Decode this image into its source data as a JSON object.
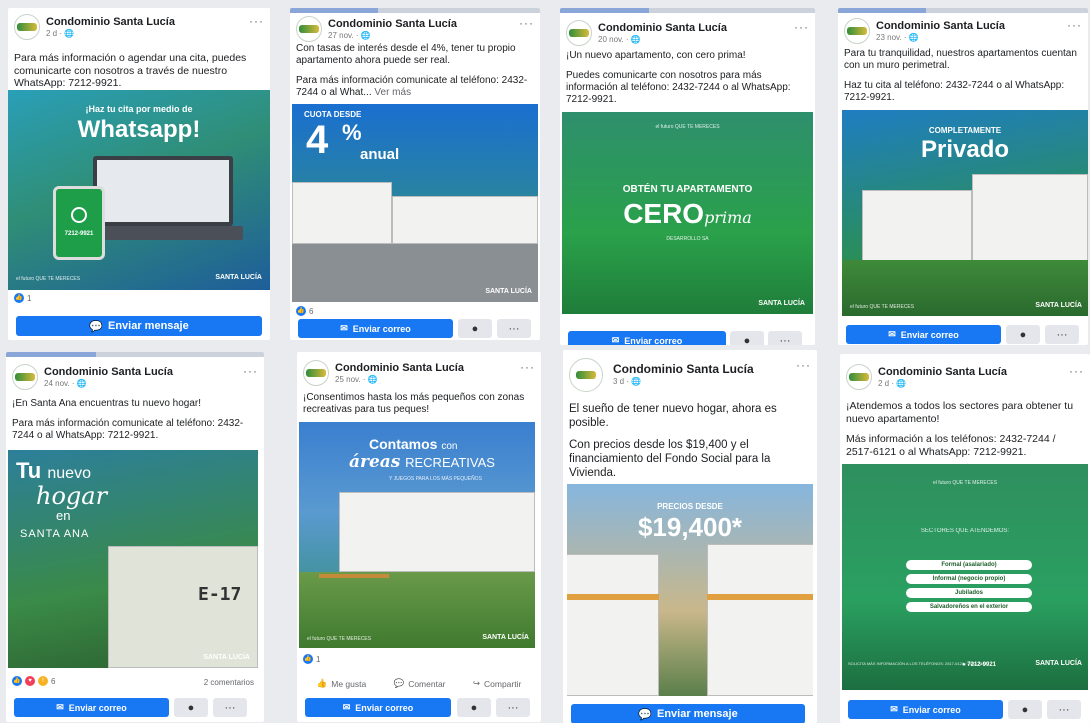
{
  "page": {
    "name": "Condominio Santa Lucía",
    "menu_dots": "···"
  },
  "icons": {
    "messenger": "messenger-icon",
    "mail": "mail-icon",
    "like": "thumbs-up-icon",
    "comment": "comment-icon",
    "share": "share-icon",
    "globe": "globe-icon"
  },
  "colors": {
    "facebook_blue": "#1877f2",
    "brand_green": "#2aa14a"
  },
  "actions": {
    "send_message": "Enviar mensaje",
    "send_email": "Enviar correo",
    "like": "Me gusta",
    "comment": "Comentar",
    "share": "Compartir"
  },
  "posts": [
    {
      "date": "2 d ·",
      "text": [
        "Para más información o agendar una cita, puedes comunicarte con nosotros a través de nuestro WhatsApp: 7212-9921."
      ],
      "img": {
        "top": "¡Haz tu cita por medio de",
        "main": "Whatsapp!",
        "phone": "7212-9921",
        "tag": "el futuro QUE TE MERECES",
        "logo": "SANTA LUCÍA"
      },
      "reactions": "1",
      "button": "Enviar mensaje"
    },
    {
      "date": "27 nov. ·",
      "text": [
        "Con tasas de interés desde el 4%, tener tu propio apartamento ahora puede ser real.",
        "Para más información comunicate al teléfono: 2432-7244 o al What..."
      ],
      "see_more": "Ver más",
      "img": {
        "top": "CUOTA DESDE",
        "big": "4",
        "pct": "%",
        "sub": "anual",
        "logo": "SANTA LUCÍA"
      },
      "reactions": "6",
      "button": "Enviar correo"
    },
    {
      "date": "20 nov. ·",
      "text": [
        "¡Un nuevo apartamento, con cero prima!",
        "Puedes comunicarte con nosotros para más información al teléfono: 2432-7244 o al WhatsApp: 7212-9921."
      ],
      "img": {
        "tag": "el futuro QUE TE MERECES",
        "top": "OBTÉN TU APARTAMENTO",
        "main": "CERO",
        "script": "prima",
        "note": "DESARROLLO SA",
        "logo": "SANTA LUCÍA"
      },
      "button": "Enviar correo"
    },
    {
      "date": "23 nov. ·",
      "text": [
        "Para tu tranquilidad, nuestros apartamentos cuentan con un muro perimetral.",
        "Haz tu cita al teléfono: 2432-7244  o al WhatsApp: 7212-9921."
      ],
      "img": {
        "top": "COMPLETAMENTE",
        "main": "Privado",
        "tag": "el futuro QUE TE MERECES",
        "logo": "SANTA LUCÍA"
      },
      "button": "Enviar correo"
    },
    {
      "date": "24 nov. ·",
      "text": [
        "¡En Santa Ana encuentras tu nuevo hogar!",
        "Para más información comunicate al teléfono: 2432-7244 o al WhatsApp: 7212-9921."
      ],
      "img": {
        "line1a": "Tu",
        "line1b": "nuevo",
        "line2": "hogar",
        "line3": "en",
        "line4": "SANTA ANA",
        "wall": "E-17",
        "logo": "SANTA LUCÍA"
      },
      "reactions": "6",
      "comments": "2 comentarios",
      "button": "Enviar correo"
    },
    {
      "date": "25 nov. ·",
      "text": [
        "¡Consentimos hasta los más pequeños con zonas recreativas para tus peques!"
      ],
      "img": {
        "main": "Contamos",
        "con": "con",
        "script": "áreas",
        "main2": "RECREATIVAS",
        "small": "Y JUEGOS PARA LOS MÁS PEQUEÑOS",
        "tag": "el futuro QUE TE MERECES",
        "logo": "SANTA LUCÍA"
      },
      "reactions": "1",
      "button": "Enviar correo"
    },
    {
      "date": "3 d ·",
      "text": [
        "El sueño de tener nuevo hogar, ahora es posible.",
        "Con precios desde los $19,400 y el financiamiento del Fondo Social para la Vivienda."
      ],
      "img": {
        "top": "PRECIOS DESDE",
        "main": "$19,400*"
      },
      "button": "Enviar mensaje"
    },
    {
      "date": "2 d ·",
      "text": [
        "¡Atendemos a todos los sectores para obtener tu nuevo apartamento!",
        "Más información a los teléfonos: 2432-7244 / 2517-6121 o al WhatsApp: 7212-9921."
      ],
      "img": {
        "tag": "el futuro QUE TE MERECES",
        "heading": "SECTORES QUE ATENDEMOS:",
        "sectors": [
          "Formal (asalariado)",
          "Informal (negocio propio)",
          "Jubilados",
          "Salvadoreños en el exterior"
        ],
        "footer": "SOLICITA MÁS INFORMACIÓN A LOS TELÉFONOS: 2517-6121 / 2432-7244",
        "phone": "7212-9921",
        "logo": "SANTA LUCÍA"
      },
      "button": "Enviar correo"
    }
  ]
}
